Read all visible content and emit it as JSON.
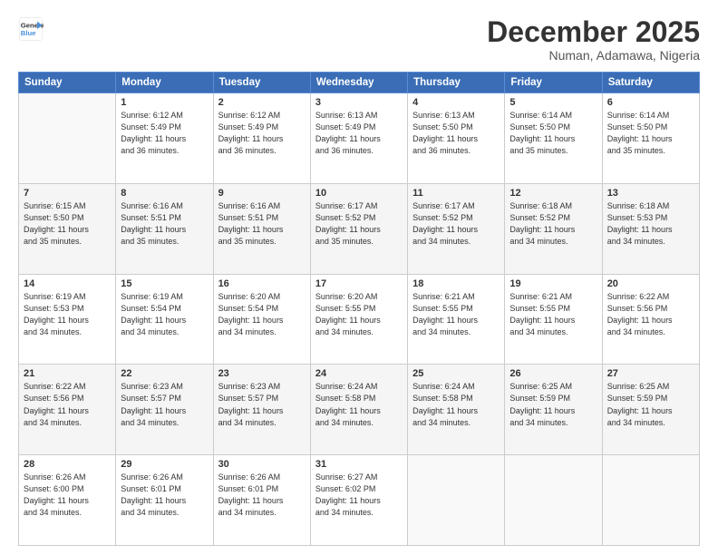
{
  "logo": {
    "line1": "General",
    "line2": "Blue"
  },
  "header": {
    "month": "December 2025",
    "location": "Numan, Adamawa, Nigeria"
  },
  "weekdays": [
    "Sunday",
    "Monday",
    "Tuesday",
    "Wednesday",
    "Thursday",
    "Friday",
    "Saturday"
  ],
  "weeks": [
    [
      {
        "day": "",
        "info": ""
      },
      {
        "day": "1",
        "info": "Sunrise: 6:12 AM\nSunset: 5:49 PM\nDaylight: 11 hours\nand 36 minutes."
      },
      {
        "day": "2",
        "info": "Sunrise: 6:12 AM\nSunset: 5:49 PM\nDaylight: 11 hours\nand 36 minutes."
      },
      {
        "day": "3",
        "info": "Sunrise: 6:13 AM\nSunset: 5:49 PM\nDaylight: 11 hours\nand 36 minutes."
      },
      {
        "day": "4",
        "info": "Sunrise: 6:13 AM\nSunset: 5:50 PM\nDaylight: 11 hours\nand 36 minutes."
      },
      {
        "day": "5",
        "info": "Sunrise: 6:14 AM\nSunset: 5:50 PM\nDaylight: 11 hours\nand 35 minutes."
      },
      {
        "day": "6",
        "info": "Sunrise: 6:14 AM\nSunset: 5:50 PM\nDaylight: 11 hours\nand 35 minutes."
      }
    ],
    [
      {
        "day": "7",
        "info": "Sunrise: 6:15 AM\nSunset: 5:50 PM\nDaylight: 11 hours\nand 35 minutes."
      },
      {
        "day": "8",
        "info": "Sunrise: 6:16 AM\nSunset: 5:51 PM\nDaylight: 11 hours\nand 35 minutes."
      },
      {
        "day": "9",
        "info": "Sunrise: 6:16 AM\nSunset: 5:51 PM\nDaylight: 11 hours\nand 35 minutes."
      },
      {
        "day": "10",
        "info": "Sunrise: 6:17 AM\nSunset: 5:52 PM\nDaylight: 11 hours\nand 35 minutes."
      },
      {
        "day": "11",
        "info": "Sunrise: 6:17 AM\nSunset: 5:52 PM\nDaylight: 11 hours\nand 34 minutes."
      },
      {
        "day": "12",
        "info": "Sunrise: 6:18 AM\nSunset: 5:52 PM\nDaylight: 11 hours\nand 34 minutes."
      },
      {
        "day": "13",
        "info": "Sunrise: 6:18 AM\nSunset: 5:53 PM\nDaylight: 11 hours\nand 34 minutes."
      }
    ],
    [
      {
        "day": "14",
        "info": "Sunrise: 6:19 AM\nSunset: 5:53 PM\nDaylight: 11 hours\nand 34 minutes."
      },
      {
        "day": "15",
        "info": "Sunrise: 6:19 AM\nSunset: 5:54 PM\nDaylight: 11 hours\nand 34 minutes."
      },
      {
        "day": "16",
        "info": "Sunrise: 6:20 AM\nSunset: 5:54 PM\nDaylight: 11 hours\nand 34 minutes."
      },
      {
        "day": "17",
        "info": "Sunrise: 6:20 AM\nSunset: 5:55 PM\nDaylight: 11 hours\nand 34 minutes."
      },
      {
        "day": "18",
        "info": "Sunrise: 6:21 AM\nSunset: 5:55 PM\nDaylight: 11 hours\nand 34 minutes."
      },
      {
        "day": "19",
        "info": "Sunrise: 6:21 AM\nSunset: 5:55 PM\nDaylight: 11 hours\nand 34 minutes."
      },
      {
        "day": "20",
        "info": "Sunrise: 6:22 AM\nSunset: 5:56 PM\nDaylight: 11 hours\nand 34 minutes."
      }
    ],
    [
      {
        "day": "21",
        "info": "Sunrise: 6:22 AM\nSunset: 5:56 PM\nDaylight: 11 hours\nand 34 minutes."
      },
      {
        "day": "22",
        "info": "Sunrise: 6:23 AM\nSunset: 5:57 PM\nDaylight: 11 hours\nand 34 minutes."
      },
      {
        "day": "23",
        "info": "Sunrise: 6:23 AM\nSunset: 5:57 PM\nDaylight: 11 hours\nand 34 minutes."
      },
      {
        "day": "24",
        "info": "Sunrise: 6:24 AM\nSunset: 5:58 PM\nDaylight: 11 hours\nand 34 minutes."
      },
      {
        "day": "25",
        "info": "Sunrise: 6:24 AM\nSunset: 5:58 PM\nDaylight: 11 hours\nand 34 minutes."
      },
      {
        "day": "26",
        "info": "Sunrise: 6:25 AM\nSunset: 5:59 PM\nDaylight: 11 hours\nand 34 minutes."
      },
      {
        "day": "27",
        "info": "Sunrise: 6:25 AM\nSunset: 5:59 PM\nDaylight: 11 hours\nand 34 minutes."
      }
    ],
    [
      {
        "day": "28",
        "info": "Sunrise: 6:26 AM\nSunset: 6:00 PM\nDaylight: 11 hours\nand 34 minutes."
      },
      {
        "day": "29",
        "info": "Sunrise: 6:26 AM\nSunset: 6:01 PM\nDaylight: 11 hours\nand 34 minutes."
      },
      {
        "day": "30",
        "info": "Sunrise: 6:26 AM\nSunset: 6:01 PM\nDaylight: 11 hours\nand 34 minutes."
      },
      {
        "day": "31",
        "info": "Sunrise: 6:27 AM\nSunset: 6:02 PM\nDaylight: 11 hours\nand 34 minutes."
      },
      {
        "day": "",
        "info": ""
      },
      {
        "day": "",
        "info": ""
      },
      {
        "day": "",
        "info": ""
      }
    ]
  ]
}
